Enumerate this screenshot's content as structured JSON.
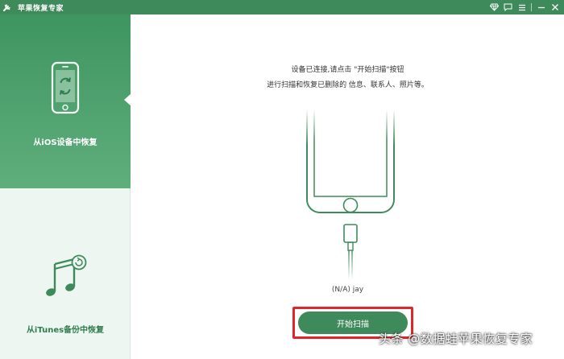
{
  "titlebar": {
    "title": "苹果恢复专家",
    "icons": [
      "tools-icon",
      "diamond-icon",
      "feedback-icon",
      "menu-icon",
      "minimize-icon",
      "close-icon"
    ]
  },
  "sidebar": {
    "items": [
      {
        "label": "从iOS设备中恢复",
        "icon": "phone-restore-icon",
        "active": true
      },
      {
        "label": "从iTunes备份中恢复",
        "icon": "music-restore-icon",
        "active": false
      }
    ]
  },
  "main": {
    "instruction_line1": "设备已连接,请点击 \"开始扫描\"按钮",
    "instruction_line2": "进行扫描和恢复已删除的 信息、联系人、照片等。",
    "device_name": "(N/A) jay",
    "scan_button_label": "开始扫描"
  },
  "watermark": "头条 @数据蛙苹果恢复专家",
  "colors": {
    "brand_green": "#3f8a5a",
    "sidebar_active_top": "#3e9560",
    "sidebar_active_bottom": "#5fae7c",
    "sidebar_bg": "#eef6f1",
    "highlight_red": "#e0262b"
  }
}
